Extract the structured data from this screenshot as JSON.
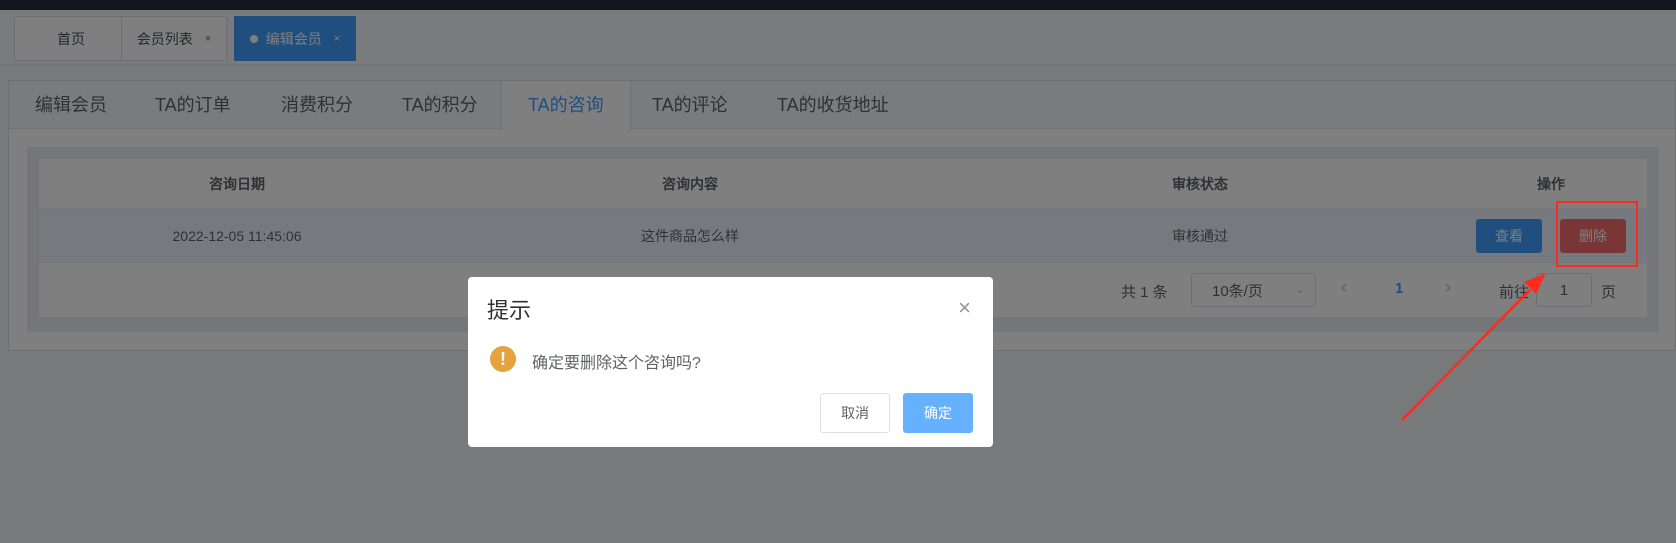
{
  "tags": [
    {
      "label": "首页",
      "closable": false,
      "active": false
    },
    {
      "label": "会员列表",
      "closable": true,
      "active": false
    },
    {
      "label": "编辑会员",
      "closable": true,
      "active": true
    }
  ],
  "tag_close": "×",
  "tabs": [
    "编辑会员",
    "TA的订单",
    "消费积分",
    "TA的积分",
    "TA的咨询",
    "TA的评论",
    "TA的收货地址"
  ],
  "active_tab": "TA的咨询",
  "table": {
    "headers": [
      "咨询日期",
      "咨询内容",
      "审核状态",
      "操作"
    ],
    "rows": [
      {
        "date": "2022-12-05 11:45:06",
        "content": "这件商品怎么样",
        "status": "审核通过",
        "view_label": "查看",
        "delete_label": "删除"
      }
    ]
  },
  "pagination": {
    "total_text": "共 1 条",
    "page_size": "10条/页",
    "current_page": "1",
    "goto_label": "前往",
    "goto_value": "1",
    "page_suffix": "页"
  },
  "dialog": {
    "title": "提示",
    "message": "确定要删除这个咨询吗?",
    "cancel_label": "取消",
    "confirm_label": "确定",
    "close_glyph": "×",
    "icon_glyph": "!"
  },
  "colors": {
    "primary": "#409eff",
    "danger": "#f56c6c",
    "warning": "#e6a23c",
    "annotation": "#ff2a1e"
  }
}
